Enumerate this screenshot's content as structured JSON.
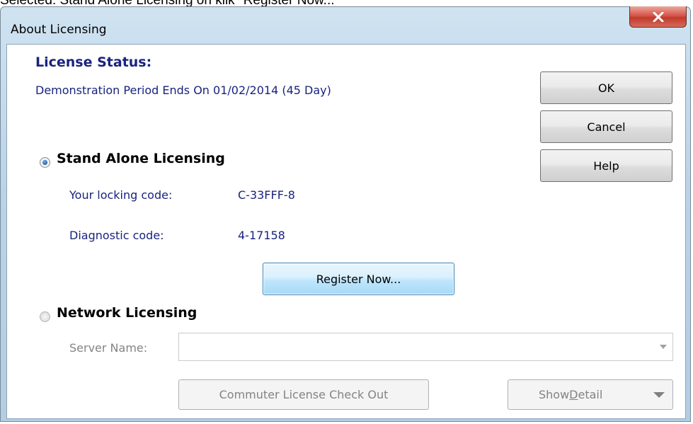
{
  "caption": "Selected: Stand Alone Licensing on klik \"Register Now...\"",
  "window": {
    "title": "About Licensing"
  },
  "license": {
    "title": "License Status:",
    "status": "Demonstration Period Ends On 01/02/2014 (45 Day)"
  },
  "stand_alone": {
    "label": "Stand Alone Licensing",
    "selected": true,
    "locking_label": "Your locking code:",
    "locking_value": "C-33FFF-8",
    "diagnostic_label": "Diagnostic code:",
    "diagnostic_value": "4-17158",
    "register_label": "Register Now..."
  },
  "network": {
    "label": "Network Licensing",
    "selected": false,
    "server_label": "Server Name:",
    "server_value": "",
    "commuter_label": "Commuter License Check Out",
    "show_detail_pre": "Show ",
    "show_detail_key": "D",
    "show_detail_post": "etail"
  },
  "buttons": {
    "ok": "OK",
    "cancel": "Cancel",
    "help": "Help"
  },
  "icons": {
    "close": "close-icon",
    "dropdown": "chevron-down-icon",
    "radio": "radio-button"
  },
  "colors": {
    "label_blue": "#1a237e",
    "close_red": "#c13b2c",
    "focus_blue": "#3c7fb1",
    "disabled_gray": "#838383"
  }
}
